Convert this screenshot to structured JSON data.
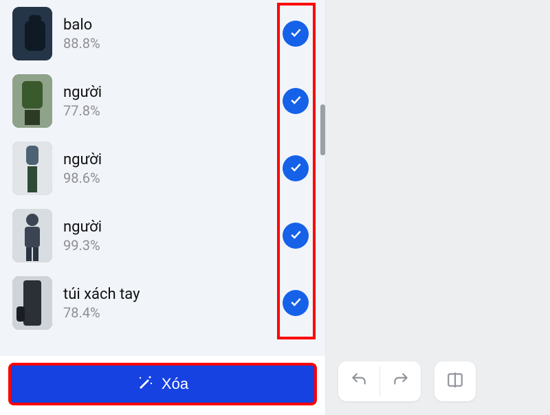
{
  "items": [
    {
      "label": "balo",
      "confidence": "88.8%",
      "checked": true
    },
    {
      "label": "người",
      "confidence": "77.8%",
      "checked": true
    },
    {
      "label": "người",
      "confidence": "98.6%",
      "checked": true
    },
    {
      "label": "người",
      "confidence": "99.3%",
      "checked": true
    },
    {
      "label": "túi xách tay",
      "confidence": "78.4%",
      "checked": true
    }
  ],
  "actions": {
    "delete_label": "Xóa"
  },
  "colors": {
    "accent": "#1742e2",
    "checkmark": "#1561e8",
    "highlight": "#ff0000"
  },
  "thumbnail_palette": [
    "#233546",
    "#3a5a2e",
    "#4d6273",
    "#3b4452",
    "#2b2f36"
  ]
}
